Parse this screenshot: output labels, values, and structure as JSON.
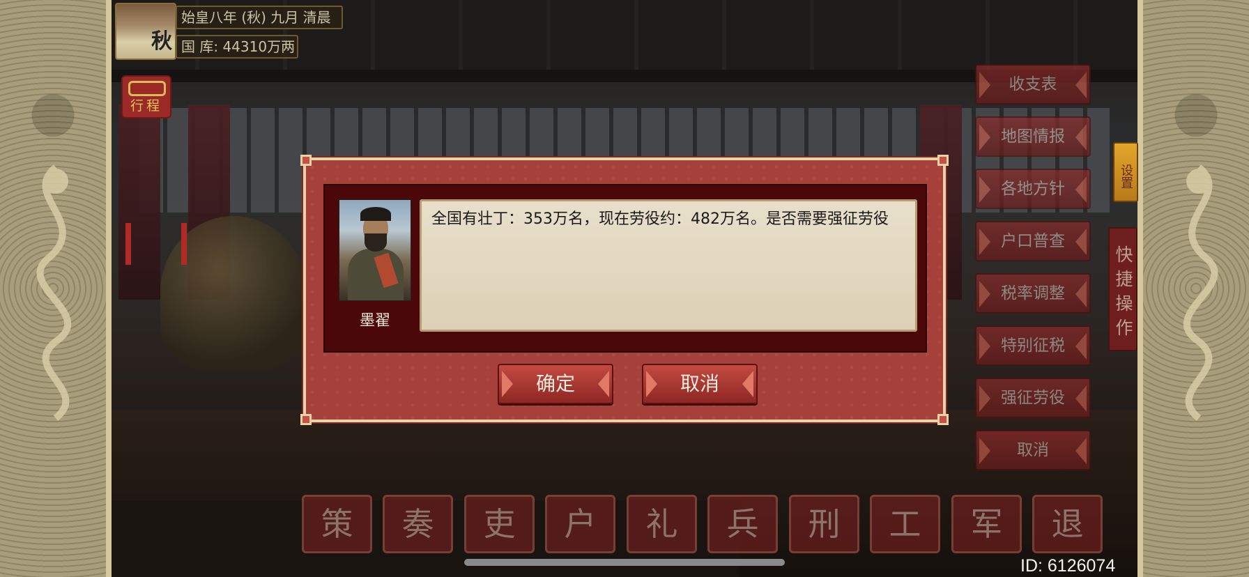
{
  "header": {
    "season": "秋",
    "date": "始皇八年 (秋) 九月 清晨",
    "treasury": "国 库: 44310万两"
  },
  "itinerary_label": "行程",
  "right_menu": [
    "收支表",
    "地图情报",
    "各地方针",
    "户口普查",
    "税率调整",
    "特别征税",
    "强征劳役",
    "取消"
  ],
  "settings_label": "设置",
  "quick_ops_label": "快捷操作",
  "ministries": [
    "策",
    "奏",
    "吏",
    "户",
    "礼",
    "兵",
    "刑",
    "工",
    "军",
    "退"
  ],
  "dialog": {
    "speaker": "墨翟",
    "message": "全国有壮丁：353万名，现在劳役约：482万名。是否需要强征劳役",
    "confirm_label": "确定",
    "cancel_label": "取消"
  },
  "footer": {
    "id_text": "ID: 6126074"
  },
  "colors": {
    "dialog_red": "#a5403b",
    "border_cream": "#e9d2a3",
    "message_bg": "#e8dfcb"
  }
}
